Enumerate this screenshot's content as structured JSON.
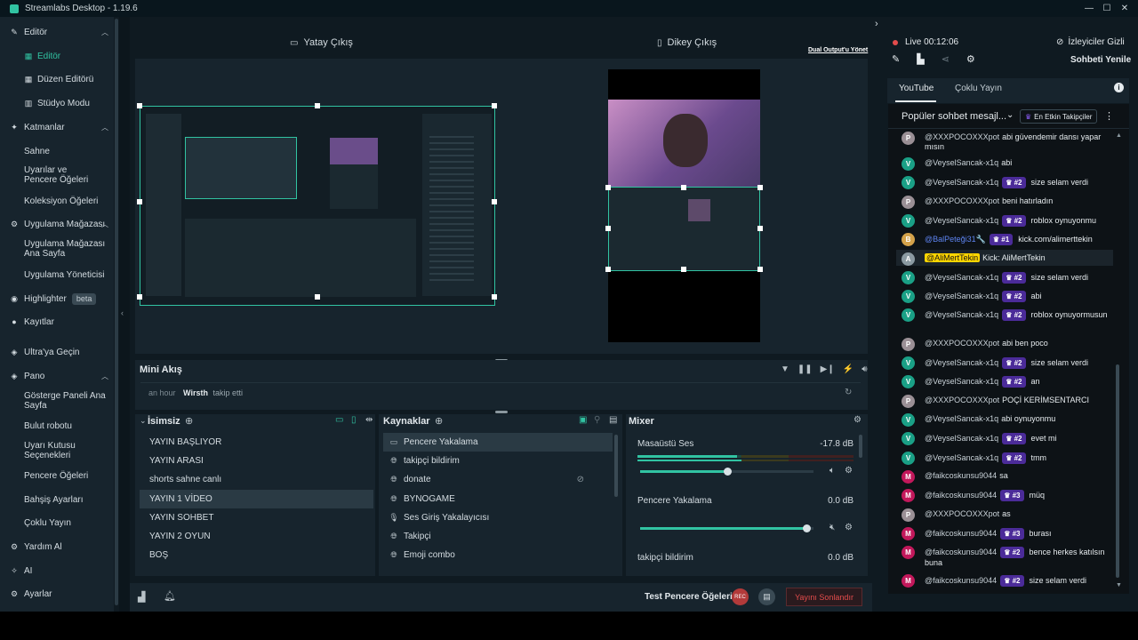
{
  "window": {
    "title": "Streamlabs Desktop - 1.19.6",
    "minimize": "—",
    "maximize": "☐",
    "close": "✕"
  },
  "sidebar": {
    "editor": "Editör",
    "editor_sub": "Editör",
    "layout_editor": "Düzen Editörü",
    "studio_mode": "Stüdyo Modu",
    "layers": "Katmanlar",
    "scene": "Sahne",
    "alerts_window": "Uyarılar ve Pencere Öğeleri",
    "collection": "Koleksiyon Öğeleri",
    "app_store": "Uygulama Mağazası",
    "app_store_home": "Uygulama Mağazası Ana Sayfa",
    "app_manager": "Uygulama Yöneticisi",
    "highlighter": "Highlighter",
    "beta": "beta",
    "recordings": "Kayıtlar",
    "ultra": "Ultra'ya Geçin",
    "dashboard": "Pano",
    "dashboard_home": "Gösterge Paneli Ana Sayfa",
    "cloudbot": "Bulut robotu",
    "alertbox": "Uyarı Kutusu Seçenekleri",
    "window_items": "Pencere Öğeleri",
    "tip_settings": "Bahşiş Ayarları",
    "multistream": "Çoklu Yayın",
    "help": "Yardım Al",
    "ai": "AI",
    "settings": "Ayarlar"
  },
  "preview": {
    "horizontal": "Yatay Çıkış",
    "vertical": "Dikey Çıkış",
    "dual_output": "Dual Output'u Yönet"
  },
  "mini_feed": {
    "title": "Mini Akış",
    "time": "an hour",
    "user": "Wirsth",
    "action": "takip etti"
  },
  "scenes": {
    "title": "İsimsiz",
    "items": [
      "YAYIN BAŞLIYOR",
      "YAYIN ARASI",
      "shorts sahne canlı",
      "YAYIN 1 VİDEO",
      "YAYIN SOHBET",
      "YAYIN 2 OYUN",
      "BOŞ"
    ]
  },
  "sources": {
    "title": "Kaynaklar",
    "items": [
      {
        "label": "Pencere Yakalama",
        "icon": "window-icon"
      },
      {
        "label": "takipçi bildirim",
        "icon": "globe-icon"
      },
      {
        "label": "donate",
        "icon": "globe-icon"
      },
      {
        "label": "BYNOGAME",
        "icon": "globe-icon"
      },
      {
        "label": "Ses Giriş Yakalayıcısı",
        "icon": "microphone-icon"
      },
      {
        "label": "Takipçi",
        "icon": "globe-icon"
      },
      {
        "label": "Emoji combo",
        "icon": "globe-icon"
      }
    ]
  },
  "mixer": {
    "title": "Mixer",
    "channels": [
      {
        "name": "Masaüstü Ses",
        "db": "-17.8 dB",
        "level": 0.5
      },
      {
        "name": "Pencere Yakalama",
        "db": "0.0 dB",
        "level": 0.96
      },
      {
        "name": "takipçi bildirim",
        "db": "0.0 dB",
        "level": 1.0
      }
    ]
  },
  "footer": {
    "test_window": "Test Pencere Öğeleri",
    "rec": "REC",
    "end_stream": "Yayını Sonlandır"
  },
  "chat": {
    "live": "Live",
    "timer": "00:12:06",
    "viewers_hidden": "İzleyiciler Gizli",
    "refresh": "Sohbeti Yenile",
    "tab_youtube": "YouTube",
    "tab_multi": "Çoklu Yayın",
    "popular": "Popüler sohbet mesajl...",
    "top_supporters": "En Etkin Takipçiler",
    "colors": {
      "accent": "#31c3a2",
      "crown": "#4b2b99",
      "live": "#e34c4c"
    },
    "messages": [
      {
        "user": "@XXXPOCOXXXpot",
        "text": "abi güvendemir dansı yapar mısın",
        "av": "P",
        "color": "#9a8f95"
      },
      {
        "user": "@VeyselSancak-x1q",
        "text": "abi",
        "av": "V",
        "color": "#1aa086"
      },
      {
        "user": "@VeyselSancak-x1q",
        "rank": "#2",
        "text": "size selam verdi",
        "av": "V",
        "color": "#1aa086"
      },
      {
        "user": "@XXXPOCOXXXpot",
        "text": "beni hatırladın",
        "av": "P",
        "color": "#9a8f95"
      },
      {
        "user": "@VeyselSancak-x1q",
        "rank": "#2",
        "text": "roblox oynuyonmu",
        "av": "V",
        "color": "#1aa086"
      },
      {
        "user": "@BalPeteği31🔧",
        "rank": "#1",
        "text": "kick.com/alimerttekin",
        "av": "B",
        "color": "#d4a24a",
        "mod": true
      },
      {
        "user": "@AliMertTekin",
        "text": "Kick: AliMertTekin",
        "av": "A",
        "color": "#8b9aa2",
        "owner": true
      },
      {
        "user": "@VeyselSancak-x1q",
        "rank": "#2",
        "text": "size selam verdi",
        "av": "V",
        "color": "#1aa086"
      },
      {
        "user": "@VeyselSancak-x1q",
        "rank": "#2",
        "text": "abi",
        "av": "V",
        "color": "#1aa086"
      },
      {
        "user": "@VeyselSancak-x1q",
        "rank": "#2",
        "text": "roblox oynuyormusun",
        "av": "V",
        "color": "#1aa086"
      },
      {
        "user": "@XXXPOCOXXXpot",
        "text": "abi ben poco",
        "av": "P",
        "color": "#9a8f95"
      },
      {
        "user": "@VeyselSancak-x1q",
        "rank": "#2",
        "text": "size selam verdi",
        "av": "V",
        "color": "#1aa086"
      },
      {
        "user": "@VeyselSancak-x1q",
        "rank": "#2",
        "text": "an",
        "av": "V",
        "color": "#1aa086"
      },
      {
        "user": "@XXXPOCOXXXpot",
        "text": "POÇİ KERİMSENTARCI",
        "av": "P",
        "color": "#9a8f95"
      },
      {
        "user": "@VeyselSancak-x1q",
        "text": "abi oynuyonmu",
        "av": "V",
        "color": "#1aa086"
      },
      {
        "user": "@VeyselSancak-x1q",
        "rank": "#2",
        "text": "evet mi",
        "av": "V",
        "color": "#1aa086"
      },
      {
        "user": "@VeyselSancak-x1q",
        "rank": "#2",
        "text": "tmm",
        "av": "V",
        "color": "#1aa086"
      },
      {
        "user": "@faikcoskunsu9044",
        "text": "sa",
        "av": "M",
        "color": "#c2185b"
      },
      {
        "user": "@faikcoskunsu9044",
        "rank": "#3",
        "text": "müq",
        "av": "M",
        "color": "#c2185b"
      },
      {
        "user": "@XXXPOCOXXXpot",
        "text": "as",
        "av": "P",
        "color": "#9a8f95"
      },
      {
        "user": "@faikcoskunsu9044",
        "rank": "#3",
        "text": "burası",
        "av": "M",
        "color": "#c2185b"
      },
      {
        "user": "@faikcoskunsu9044",
        "rank": "#2",
        "text": "bence herkes katılsın buna",
        "av": "M",
        "color": "#c2185b"
      },
      {
        "user": "@faikcoskunsu9044",
        "rank": "#2",
        "text": "size selam verdi",
        "av": "M",
        "color": "#c2185b"
      }
    ]
  }
}
